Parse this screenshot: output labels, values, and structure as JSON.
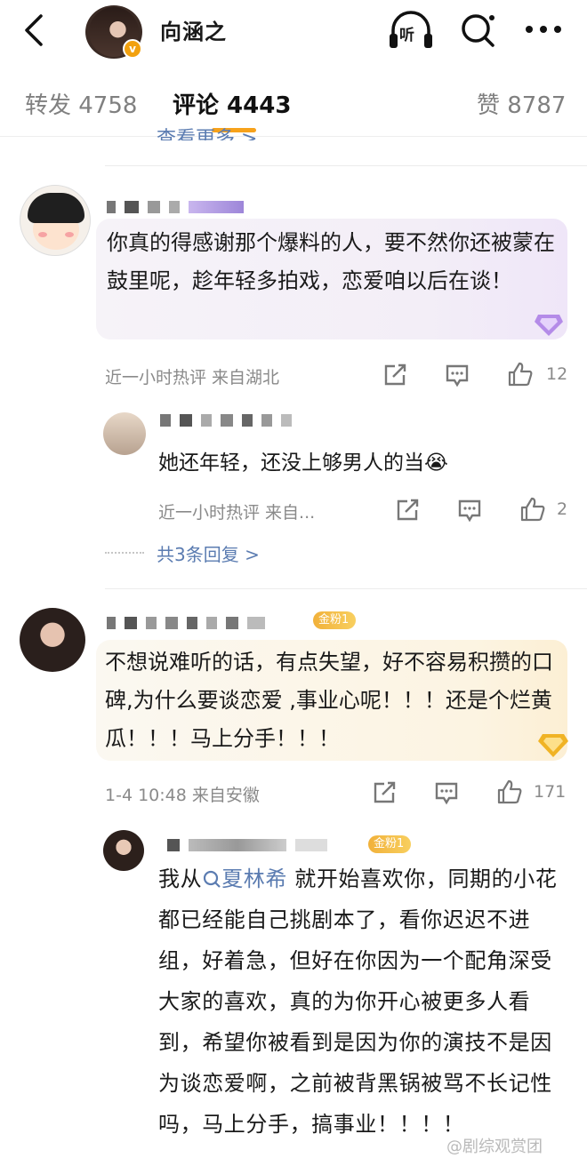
{
  "header": {
    "author_name": "向涵之",
    "verified_badge": "v",
    "listen_label": "听",
    "icons": [
      "back-icon",
      "headphones-icon",
      "search-icon",
      "more-icon"
    ]
  },
  "tabs": [
    {
      "label": "转发 4758"
    },
    {
      "label": "评论 4443"
    },
    {
      "label": "赞 8787"
    }
  ],
  "see_more": "查看更多 >",
  "comments": [
    {
      "text": "你真的得感谢那个爆料的人，要不然你还被蒙在鼓里呢，趁年轻多拍戏，恋爱咱以后在谈！",
      "meta": "近一小时热评  来自湖北",
      "likes": "12",
      "reply": {
        "text": "她还年轻，还没上够男人的当😭",
        "meta": "近一小时热评  来自...",
        "likes": "2"
      },
      "replies_link": "共3条回复 >"
    },
    {
      "fan_badge": "金粉1",
      "text": "不想说难听的话，有点失望，好不容易积攒的口碑,为什么要谈恋爱 ,事业心呢！！！还是个烂黄瓜！！！马上分手！！！",
      "meta": "1-4 10:48  来自安徽",
      "likes": "171",
      "reply": {
        "fan_badge": "金粉1",
        "text_before": "我从",
        "topic": "夏林希",
        "text_after": "就开始喜欢你，同期的小花都已经能自己挑剧本了，看你迟迟不进组，好着急，但好在你因为一个配角深受大家的喜欢，真的为你开心被更多人看到，希望你被看到是因为你的演技不是因为谈恋爱啊，之前被背黑锅被骂不长记性吗，马上分手，搞事业！！！！"
      }
    }
  ],
  "watermark": "@剧综观赏团",
  "colors": {
    "accent": "#f7a21b",
    "link": "#5b7cb1",
    "meta": "#8a8a8a"
  }
}
